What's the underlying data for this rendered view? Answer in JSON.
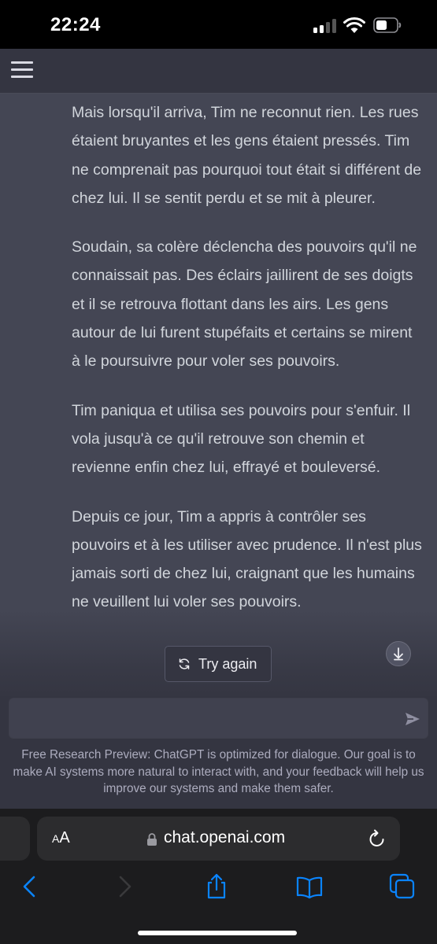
{
  "status_bar": {
    "time": "22:24",
    "icons": [
      "cellular-signal-icon",
      "wifi-icon",
      "battery-icon"
    ]
  },
  "header": {
    "menu_icon": "hamburger-menu-icon"
  },
  "conversation": {
    "paragraphs": [
      "Mais lorsqu'il arriva, Tim ne reconnut rien. Les rues étaient bruyantes et les gens étaient pressés. Tim ne comprenait pas pourquoi tout était si différent de chez lui. Il se sentit perdu et se mit à pleurer.",
      "Soudain, sa colère déclencha des pouvoirs qu'il ne connaissait pas. Des éclairs jaillirent de ses doigts et il se retrouva flottant dans les airs. Les gens autour de lui furent stupéfaits et certains se mirent à le poursuivre pour voler ses pouvoirs.",
      "Tim paniqua et utilisa ses pouvoirs pour s'enfuir. Il vola jusqu'à ce qu'il retrouve son chemin et revienne enfin chez lui, effrayé et bouleversé.",
      "Depuis ce jour, Tim a appris à contrôler ses pouvoirs et à les utiliser avec prudence. Il n'est plus jamais sorti de chez lui, craignant que les humains ne veuillent lui voler ses pouvoirs."
    ],
    "try_again_label": "Try again",
    "try_again_icon": "refresh-icon",
    "scroll_down_icon": "arrow-down-icon"
  },
  "composer": {
    "input_value": "",
    "input_placeholder": "",
    "send_icon": "send-icon"
  },
  "disclaimer": "Free Research Preview: ChatGPT is optimized for dialogue. Our goal is to make AI systems more natural to interact with, and your feedback will help us improve our systems and make them safer.",
  "browser": {
    "aa_label_small": "A",
    "aa_label_large": "A",
    "url": "chat.openai.com",
    "toolbar_icons": [
      "back-icon",
      "forward-icon",
      "share-icon",
      "bookmarks-icon",
      "tabs-icon"
    ]
  },
  "colors": {
    "chat_background": "#444654",
    "app_background": "#343541",
    "text": "#d1d5db",
    "link_blue": "#0a84ff"
  }
}
